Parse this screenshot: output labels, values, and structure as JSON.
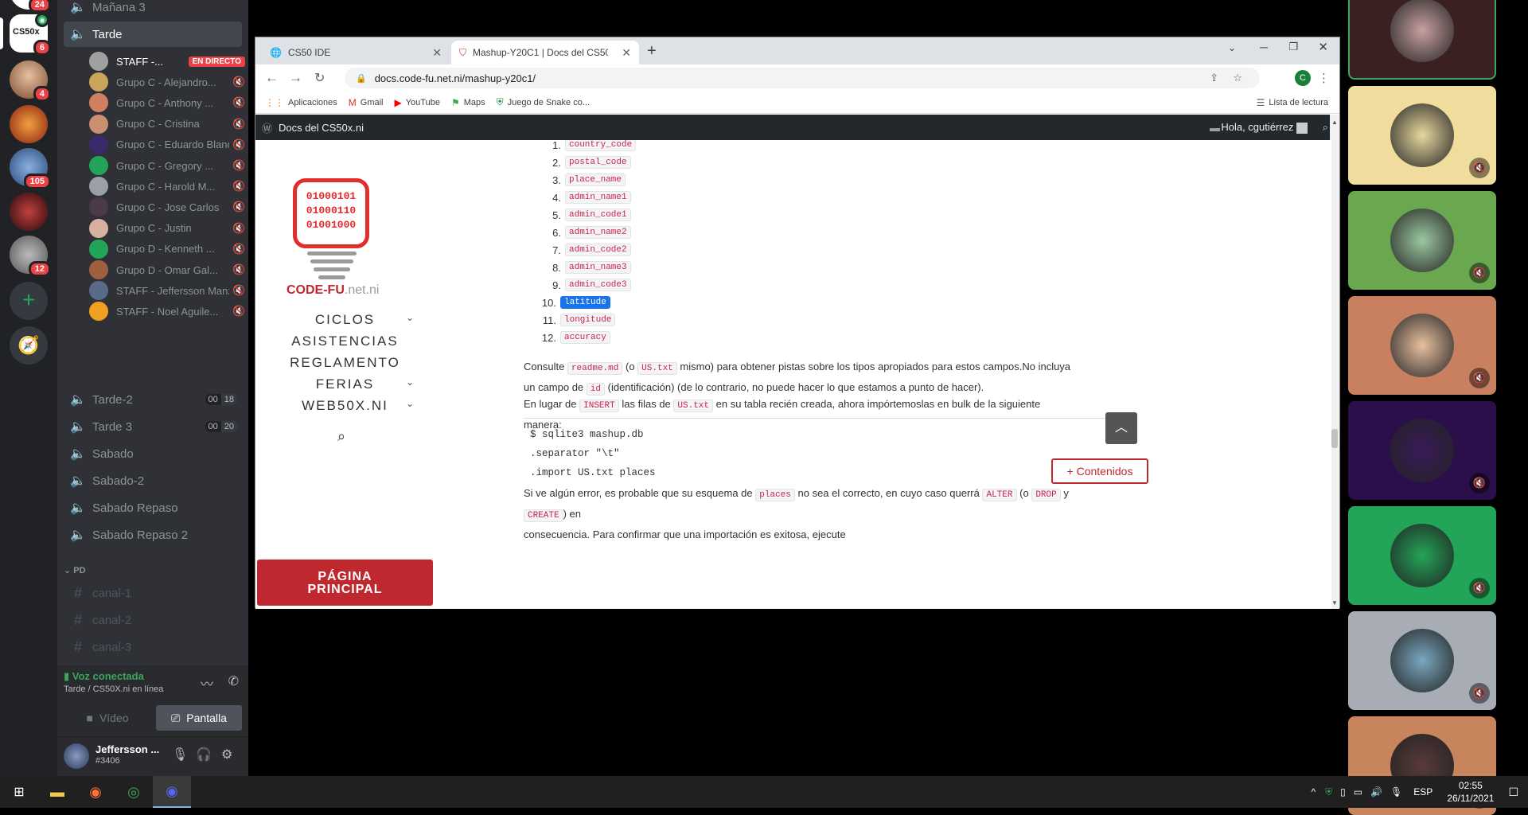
{
  "discord": {
    "servers": [
      {
        "name": "CS50x",
        "badge": "6",
        "color": "#ffffff"
      },
      {
        "name": "server-2",
        "badge": "4",
        "color": "#b07050"
      },
      {
        "name": "server-3",
        "badge": "",
        "color": "#c04020"
      },
      {
        "name": "server-4",
        "badge": "105",
        "color": "#4a6fa5"
      },
      {
        "name": "server-5",
        "badge": "",
        "color": "#8a2020"
      },
      {
        "name": "server-6",
        "badge": "12",
        "color": "#777"
      }
    ],
    "top_badge": "24",
    "channel_above": "Mañana 3",
    "selected_channel": "Tarde",
    "voice_users": [
      {
        "name": "STAFF -...",
        "live": "EN DIRECTO",
        "color": "#a0a0a0"
      },
      {
        "name": "Grupo C - Alejandro...",
        "color": "#c9a45a"
      },
      {
        "name": "Grupo C - Anthony ...",
        "color": "#d08060"
      },
      {
        "name": "Grupo C - Cristina",
        "color": "#c89070"
      },
      {
        "name": "Grupo C - Eduardo Bland...",
        "color": "#3a2a6a"
      },
      {
        "name": "Grupo C - Gregory ...",
        "color": "#23a559"
      },
      {
        "name": "Grupo C - Harold M...",
        "color": "#9aa0a6"
      },
      {
        "name": "Grupo C - Jose Carlos",
        "color": "#4a3a4a"
      },
      {
        "name": "Grupo C - Justin",
        "color": "#d8b0a0"
      },
      {
        "name": "Grupo D - Kenneth ...",
        "color": "#23a559"
      },
      {
        "name": "Grupo D - Omar Gal...",
        "color": "#a06040"
      },
      {
        "name": "STAFF - Jeffersson Manz...",
        "color": "#5a6a8a"
      },
      {
        "name": "STAFF - Noel Aguile...",
        "color": "#f0a020"
      }
    ],
    "voice_channels": [
      {
        "name": "Tarde-2",
        "c1": "00",
        "c2": "18"
      },
      {
        "name": "Tarde 3",
        "c1": "00",
        "c2": "20"
      },
      {
        "name": "Sabado"
      },
      {
        "name": "Sabado-2"
      },
      {
        "name": "Sabado Repaso"
      },
      {
        "name": "Sabado Repaso 2"
      }
    ],
    "category": "PD",
    "text_channels": [
      "canal-1",
      "canal-2",
      "canal-3"
    ],
    "voice_status": "Voz conectada",
    "voice_location": "Tarde / CS50X.ni en línea",
    "video_label": "Vídeo",
    "screen_label": "Pantalla",
    "username": "Jeffersson ...",
    "tag": "#3406"
  },
  "browser": {
    "tabs": [
      {
        "title": "CS50 IDE"
      },
      {
        "title": "Mashup-Y20C1 | Docs del CS50x"
      }
    ],
    "url": "docs.code-fu.net.ni/mashup-y20c1/",
    "bookmarks": [
      "Aplicaciones",
      "Gmail",
      "YouTube",
      "Maps",
      "Juego de Snake co..."
    ],
    "reading_list": "Lista de lectura",
    "profile_initial": "C",
    "wp_site": "Docs del CS50x.ni",
    "wp_greeting": "Hola, cgutiérrez"
  },
  "site": {
    "logo_text": "CODE-FU",
    "logo_suffix": ".net.ni",
    "logo_binary": [
      "01000101",
      "01000110",
      "01001000"
    ],
    "menu": [
      {
        "label": "CICLOS",
        "chevron": true
      },
      {
        "label": "ASISTENCIAS",
        "chevron": false
      },
      {
        "label": "REGLAMENTO",
        "chevron": false
      },
      {
        "label": "FERIAS",
        "chevron": true
      },
      {
        "label": "WEB50X.NI",
        "chevron": true
      }
    ],
    "home_line1": "PÁGINA",
    "home_line2": "PRINCIPAL",
    "list": [
      {
        "n": "1.",
        "code": "country_code"
      },
      {
        "n": "2.",
        "code": "postal_code"
      },
      {
        "n": "3.",
        "code": "place_name"
      },
      {
        "n": "4.",
        "code": "admin_name1"
      },
      {
        "n": "5.",
        "code": "admin_code1"
      },
      {
        "n": "6.",
        "code": "admin_name2"
      },
      {
        "n": "7.",
        "code": "admin_code2"
      },
      {
        "n": "8.",
        "code": "admin_name3"
      },
      {
        "n": "9.",
        "code": "admin_code3"
      },
      {
        "n": "10.",
        "code": "latitude"
      },
      {
        "n": "11.",
        "code": "longitude"
      },
      {
        "n": "12.",
        "code": "accuracy"
      }
    ],
    "p1": {
      "a": "Consulte",
      "c1": "readme.md",
      "b": "(o",
      "c2": "US.txt",
      "c": "mismo) para obtener pistas sobre los tipos apropiados para estos campos.No incluya un campo de",
      "c3": "id",
      "d": "(identificación) (de lo contrario, no puede hacer lo que estamos a punto de hacer)."
    },
    "p2": {
      "a": "En lugar de",
      "c1": "INSERT",
      "b": "las filas de",
      "c2": "US.txt",
      "c": "en su tabla recién creada, ahora impórtemoslas en bulk de la siguiente manera:"
    },
    "code_lines": [
      "$ sqlite3 mashup.db",
      ".separator \"\\t\"",
      ".import US.txt places"
    ],
    "p3": {
      "a": "Si ve algún error, es probable que su esquema de",
      "c1": "places",
      "b": "no sea el correcto, en cuyo caso querrá",
      "c2": "ALTER",
      "c": "(o",
      "c3": "DROP",
      "d": "y",
      "c4": "CREATE",
      "e": ") en",
      "f": "consecuencia. Para confirmar que una importación es exitosa, ejecute"
    },
    "contents_button": "+ Contenidos"
  },
  "tiles": [
    {
      "bg": "#3a2020",
      "avatar": "#c9a0a0"
    },
    {
      "bg": "#f0dc9c",
      "avatar": "#e8d8a0"
    },
    {
      "bg": "#6aa84f",
      "avatar": "#9cc8a0"
    },
    {
      "bg": "#c98060",
      "avatar": "#e8c0a0"
    },
    {
      "bg": "#2a0f4a",
      "avatar": "#3a1a5a"
    },
    {
      "bg": "#23a559",
      "avatar": "#23a559"
    },
    {
      "bg": "#a8acb4",
      "avatar": "#7aa8c0"
    },
    {
      "bg": "#c8845c",
      "avatar": "#5a3a3a"
    }
  ],
  "taskbar": {
    "lang": "ESP",
    "time": "02:55",
    "date": "26/11/2021"
  }
}
